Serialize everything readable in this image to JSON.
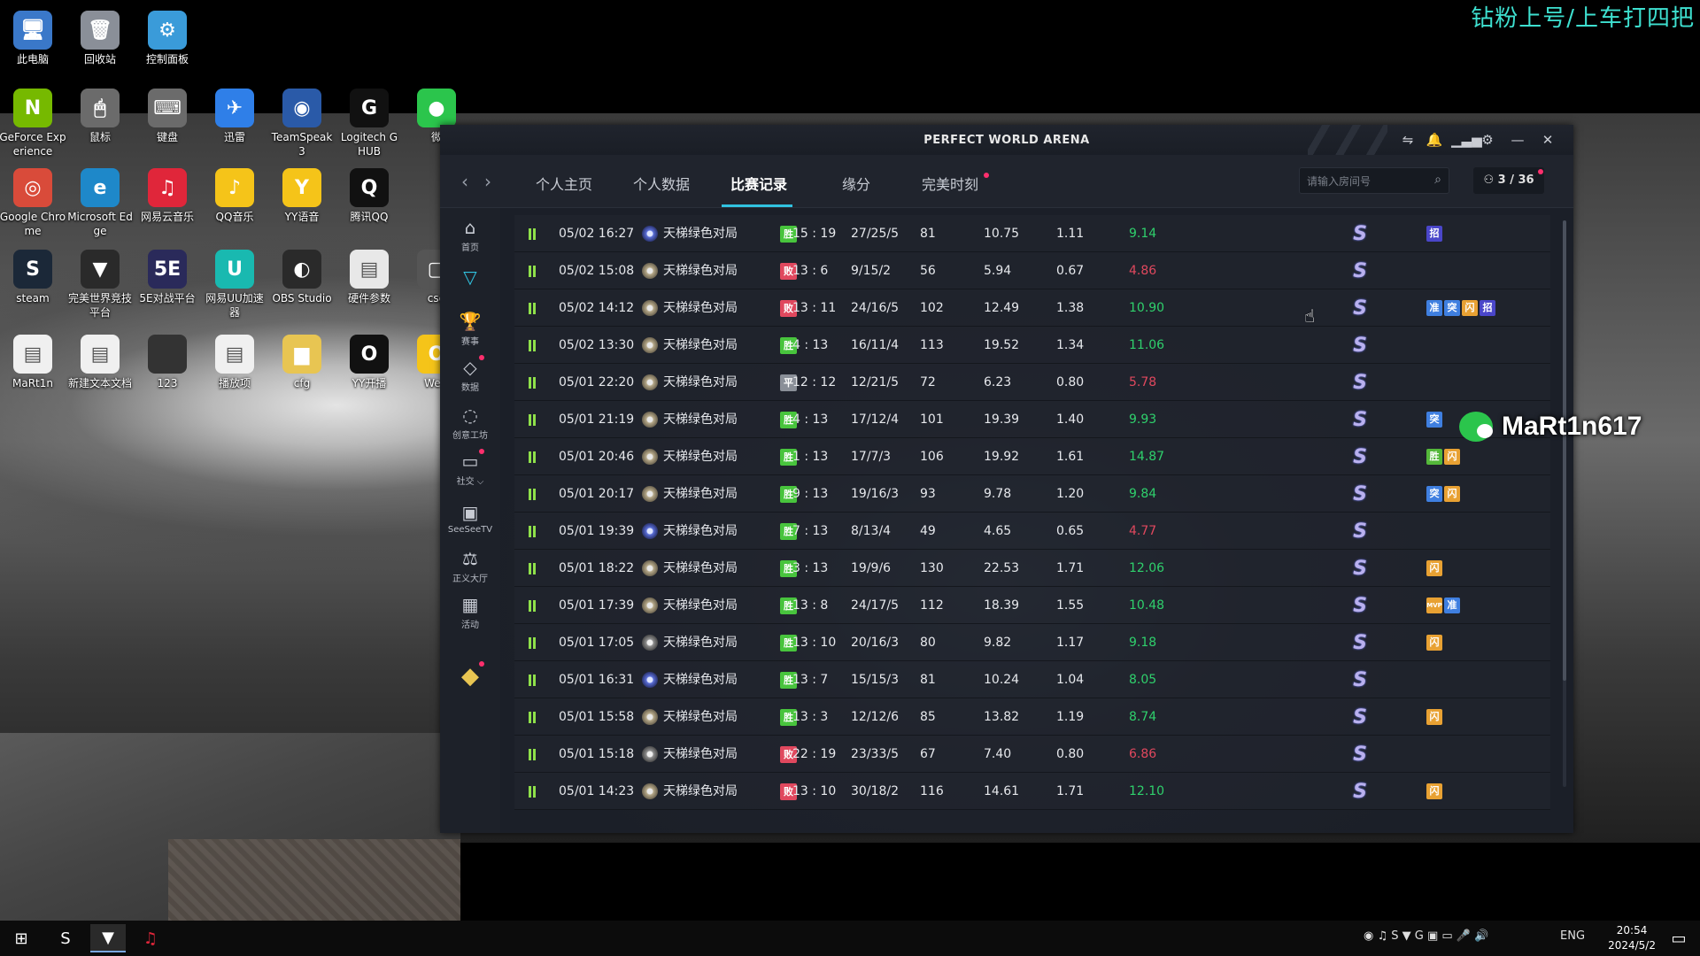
{
  "top_banner": "钻粉上号/上车打四把",
  "desktop_icons": [
    {
      "label": "此电脑",
      "glyph": "🖥",
      "color": "#3a78c9"
    },
    {
      "label": "回收站",
      "glyph": "🗑",
      "color": "#8a8f98"
    },
    {
      "label": "控制面板",
      "glyph": "⚙",
      "color": "#3a9bd9"
    },
    {
      "label": "GeForce Experience",
      "glyph": "N",
      "color": "#76b900"
    },
    {
      "label": "鼠标",
      "glyph": "🖱",
      "color": "#6b6b6b"
    },
    {
      "label": "键盘",
      "glyph": "⌨",
      "color": "#6b6b6b"
    },
    {
      "label": "迅雷",
      "glyph": "✈",
      "color": "#2f7fe8"
    },
    {
      "label": "TeamSpeak 3",
      "glyph": "◉",
      "color": "#2a5aa8"
    },
    {
      "label": "Logitech G HUB",
      "glyph": "G",
      "color": "#111111"
    },
    {
      "label": "微",
      "glyph": "●",
      "color": "#2bc54c"
    },
    {
      "label": "Google Chrome",
      "glyph": "◎",
      "color": "#d94b3a"
    },
    {
      "label": "Microsoft Edge",
      "glyph": "e",
      "color": "#1e88c9"
    },
    {
      "label": "网易云音乐",
      "glyph": "♫",
      "color": "#e0263a"
    },
    {
      "label": "QQ音乐",
      "glyph": "♪",
      "color": "#f5c419"
    },
    {
      "label": "YY语音",
      "glyph": "Y",
      "color": "#f5c419"
    },
    {
      "label": "腾讯QQ",
      "glyph": "Q",
      "color": "#111111"
    },
    {
      "label": "steam",
      "glyph": "S",
      "color": "#1b2838"
    },
    {
      "label": "完美世界竞技平台",
      "glyph": "▼",
      "color": "#2a2a2a"
    },
    {
      "label": "5E对战平台",
      "glyph": "5E",
      "color": "#2a2a5a"
    },
    {
      "label": "网易UU加速器",
      "glyph": "U",
      "color": "#19b9b0"
    },
    {
      "label": "OBS Studio",
      "glyph": "◐",
      "color": "#2a2a2a"
    },
    {
      "label": "硬件参数",
      "glyph": "▤",
      "color": "#e8e8e8"
    },
    {
      "label": "csg",
      "glyph": "▢",
      "color": "#555555"
    },
    {
      "label": "MaRt1n",
      "glyph": "▤",
      "color": "#f0f0f0"
    },
    {
      "label": "新建文本文档",
      "glyph": "▤",
      "color": "#f0f0f0"
    },
    {
      "label": "123",
      "glyph": "",
      "color": "#333333"
    },
    {
      "label": "播放项",
      "glyph": "▤",
      "color": "#f0f0f0"
    },
    {
      "label": "cfg",
      "glyph": "▆",
      "color": "#e8c552"
    },
    {
      "label": "YY开播",
      "glyph": "O",
      "color": "#111111"
    },
    {
      "label": "WeG",
      "glyph": "O",
      "color": "#f5c419"
    }
  ],
  "app": {
    "title": "PERFECT WORLD ARENA",
    "tabs": [
      {
        "label": "个人主页"
      },
      {
        "label": "个人数据"
      },
      {
        "label": "比赛记录"
      },
      {
        "label": "缘分"
      },
      {
        "label": "完美时刻"
      }
    ],
    "search_placeholder": "请输入房间号",
    "room_count": "3 / 36",
    "sidebar": [
      {
        "label": "首页",
        "glyph": "⌂"
      },
      {
        "label": "",
        "glyph": "▽"
      },
      {
        "label": "赛事",
        "glyph": "🏆"
      },
      {
        "label": "数据",
        "glyph": "◇"
      },
      {
        "label": "创意工坊",
        "glyph": "◌"
      },
      {
        "label": "社交 ⌵",
        "glyph": "▭"
      },
      {
        "label": "SeeSeeTV",
        "glyph": "▣"
      },
      {
        "label": "正义大厅",
        "glyph": "⚖"
      },
      {
        "label": "活动",
        "glyph": "▦"
      },
      {
        "label": "",
        "glyph": "◆"
      }
    ],
    "matches": [
      {
        "time": "05/02 16:27",
        "map": "天梯绿色对局",
        "map_icon": "blue",
        "result": "胜",
        "result_type": "win",
        "score": "15 : 19",
        "kda": "27/25/5",
        "adr": "81",
        "rws": "10.75",
        "rating": "1.11",
        "wepr": "9.14",
        "wepr_color": "green",
        "tags": [
          {
            "t": "招",
            "c": "purple"
          }
        ]
      },
      {
        "time": "05/02 15:08",
        "map": "天梯绿色对局",
        "map_icon": "tan",
        "result": "败",
        "result_type": "lose",
        "score": "13 : 6",
        "kda": "9/15/2",
        "adr": "56",
        "rws": "5.94",
        "rating": "0.67",
        "wepr": "4.86",
        "wepr_color": "red",
        "tags": []
      },
      {
        "time": "05/02 14:12",
        "map": "天梯绿色对局",
        "map_icon": "tan",
        "result": "败",
        "result_type": "lose",
        "score": "13 : 11",
        "kda": "24/16/5",
        "adr": "102",
        "rws": "12.49",
        "rating": "1.38",
        "wepr": "10.90",
        "wepr_color": "green",
        "tags": [
          {
            "t": "准",
            "c": "blue"
          },
          {
            "t": "突",
            "c": "blue"
          },
          {
            "t": "闪",
            "c": "orange"
          },
          {
            "t": "招",
            "c": "purple"
          }
        ]
      },
      {
        "time": "05/02 13:30",
        "map": "天梯绿色对局",
        "map_icon": "tan",
        "result": "胜",
        "result_type": "win",
        "score": "4 : 13",
        "kda": "16/11/4",
        "adr": "113",
        "rws": "19.52",
        "rating": "1.34",
        "wepr": "11.06",
        "wepr_color": "green",
        "tags": []
      },
      {
        "time": "05/01 22:20",
        "map": "天梯绿色对局",
        "map_icon": "tan",
        "result": "平",
        "result_type": "draw",
        "score": "12 : 12",
        "kda": "12/21/5",
        "adr": "72",
        "rws": "6.23",
        "rating": "0.80",
        "wepr": "5.78",
        "wepr_color": "red",
        "tags": []
      },
      {
        "time": "05/01 21:19",
        "map": "天梯绿色对局",
        "map_icon": "tan",
        "result": "胜",
        "result_type": "win",
        "score": "4 : 13",
        "kda": "17/12/4",
        "adr": "101",
        "rws": "19.39",
        "rating": "1.40",
        "wepr": "9.93",
        "wepr_color": "green",
        "tags": [
          {
            "t": "突",
            "c": "blue"
          }
        ]
      },
      {
        "time": "05/01 20:46",
        "map": "天梯绿色对局",
        "map_icon": "tan",
        "result": "胜",
        "result_type": "win",
        "score": "1 : 13",
        "kda": "17/7/3",
        "adr": "106",
        "rws": "19.92",
        "rating": "1.61",
        "wepr": "14.87",
        "wepr_color": "green",
        "tags": [
          {
            "t": "胜",
            "c": "green"
          },
          {
            "t": "闪",
            "c": "orange"
          }
        ]
      },
      {
        "time": "05/01 20:17",
        "map": "天梯绿色对局",
        "map_icon": "tan",
        "result": "胜",
        "result_type": "win",
        "score": "9 : 13",
        "kda": "19/16/3",
        "adr": "93",
        "rws": "9.78",
        "rating": "1.20",
        "wepr": "9.84",
        "wepr_color": "green",
        "tags": [
          {
            "t": "突",
            "c": "blue"
          },
          {
            "t": "闪",
            "c": "orange"
          }
        ]
      },
      {
        "time": "05/01 19:39",
        "map": "天梯绿色对局",
        "map_icon": "blue",
        "result": "胜",
        "result_type": "win",
        "score": "7 : 13",
        "kda": "8/13/4",
        "adr": "49",
        "rws": "4.65",
        "rating": "0.65",
        "wepr": "4.77",
        "wepr_color": "red",
        "tags": []
      },
      {
        "time": "05/01 18:22",
        "map": "天梯绿色对局",
        "map_icon": "tan",
        "result": "胜",
        "result_type": "win",
        "score": "3 : 13",
        "kda": "19/9/6",
        "adr": "130",
        "rws": "22.53",
        "rating": "1.71",
        "wepr": "12.06",
        "wepr_color": "green",
        "tags": [
          {
            "t": "闪",
            "c": "orange"
          }
        ]
      },
      {
        "time": "05/01 17:39",
        "map": "天梯绿色对局",
        "map_icon": "tan",
        "result": "胜",
        "result_type": "win",
        "score": "13 : 8",
        "kda": "24/17/5",
        "adr": "112",
        "rws": "18.39",
        "rating": "1.55",
        "wepr": "10.48",
        "wepr_color": "green",
        "tags": [
          {
            "t": "MVP",
            "c": "orange"
          },
          {
            "t": "准",
            "c": "blue"
          }
        ]
      },
      {
        "time": "05/01 17:05",
        "map": "天梯绿色对局",
        "map_icon": "gray",
        "result": "胜",
        "result_type": "win",
        "score": "13 : 10",
        "kda": "20/16/3",
        "adr": "80",
        "rws": "9.82",
        "rating": "1.17",
        "wepr": "9.18",
        "wepr_color": "green",
        "tags": [
          {
            "t": "闪",
            "c": "orange"
          }
        ]
      },
      {
        "time": "05/01 16:31",
        "map": "天梯绿色对局",
        "map_icon": "blue",
        "result": "胜",
        "result_type": "win",
        "score": "13 : 7",
        "kda": "15/15/3",
        "adr": "81",
        "rws": "10.24",
        "rating": "1.04",
        "wepr": "8.05",
        "wepr_color": "green",
        "tags": []
      },
      {
        "time": "05/01 15:58",
        "map": "天梯绿色对局",
        "map_icon": "tan",
        "result": "胜",
        "result_type": "win",
        "score": "13 : 3",
        "kda": "12/12/6",
        "adr": "85",
        "rws": "13.82",
        "rating": "1.19",
        "wepr": "8.74",
        "wepr_color": "green",
        "tags": [
          {
            "t": "闪",
            "c": "orange"
          }
        ]
      },
      {
        "time": "05/01 15:18",
        "map": "天梯绿色对局",
        "map_icon": "gray",
        "result": "败",
        "result_type": "lose",
        "score": "22 : 19",
        "kda": "23/33/5",
        "adr": "67",
        "rws": "7.40",
        "rating": "0.80",
        "wepr": "6.86",
        "wepr_color": "red",
        "tags": []
      },
      {
        "time": "05/01 14:23",
        "map": "天梯绿色对局",
        "map_icon": "tan",
        "result": "败",
        "result_type": "lose",
        "score": "13 : 10",
        "kda": "30/18/2",
        "adr": "116",
        "rws": "14.61",
        "rating": "1.71",
        "wepr": "12.10",
        "wepr_color": "green",
        "tags": [
          {
            "t": "闪",
            "c": "orange"
          }
        ]
      }
    ]
  },
  "overlay_name": "MaRt1n617",
  "taskbar": {
    "lang": "ENG",
    "time": "20:54",
    "date": "2024/5/2"
  }
}
